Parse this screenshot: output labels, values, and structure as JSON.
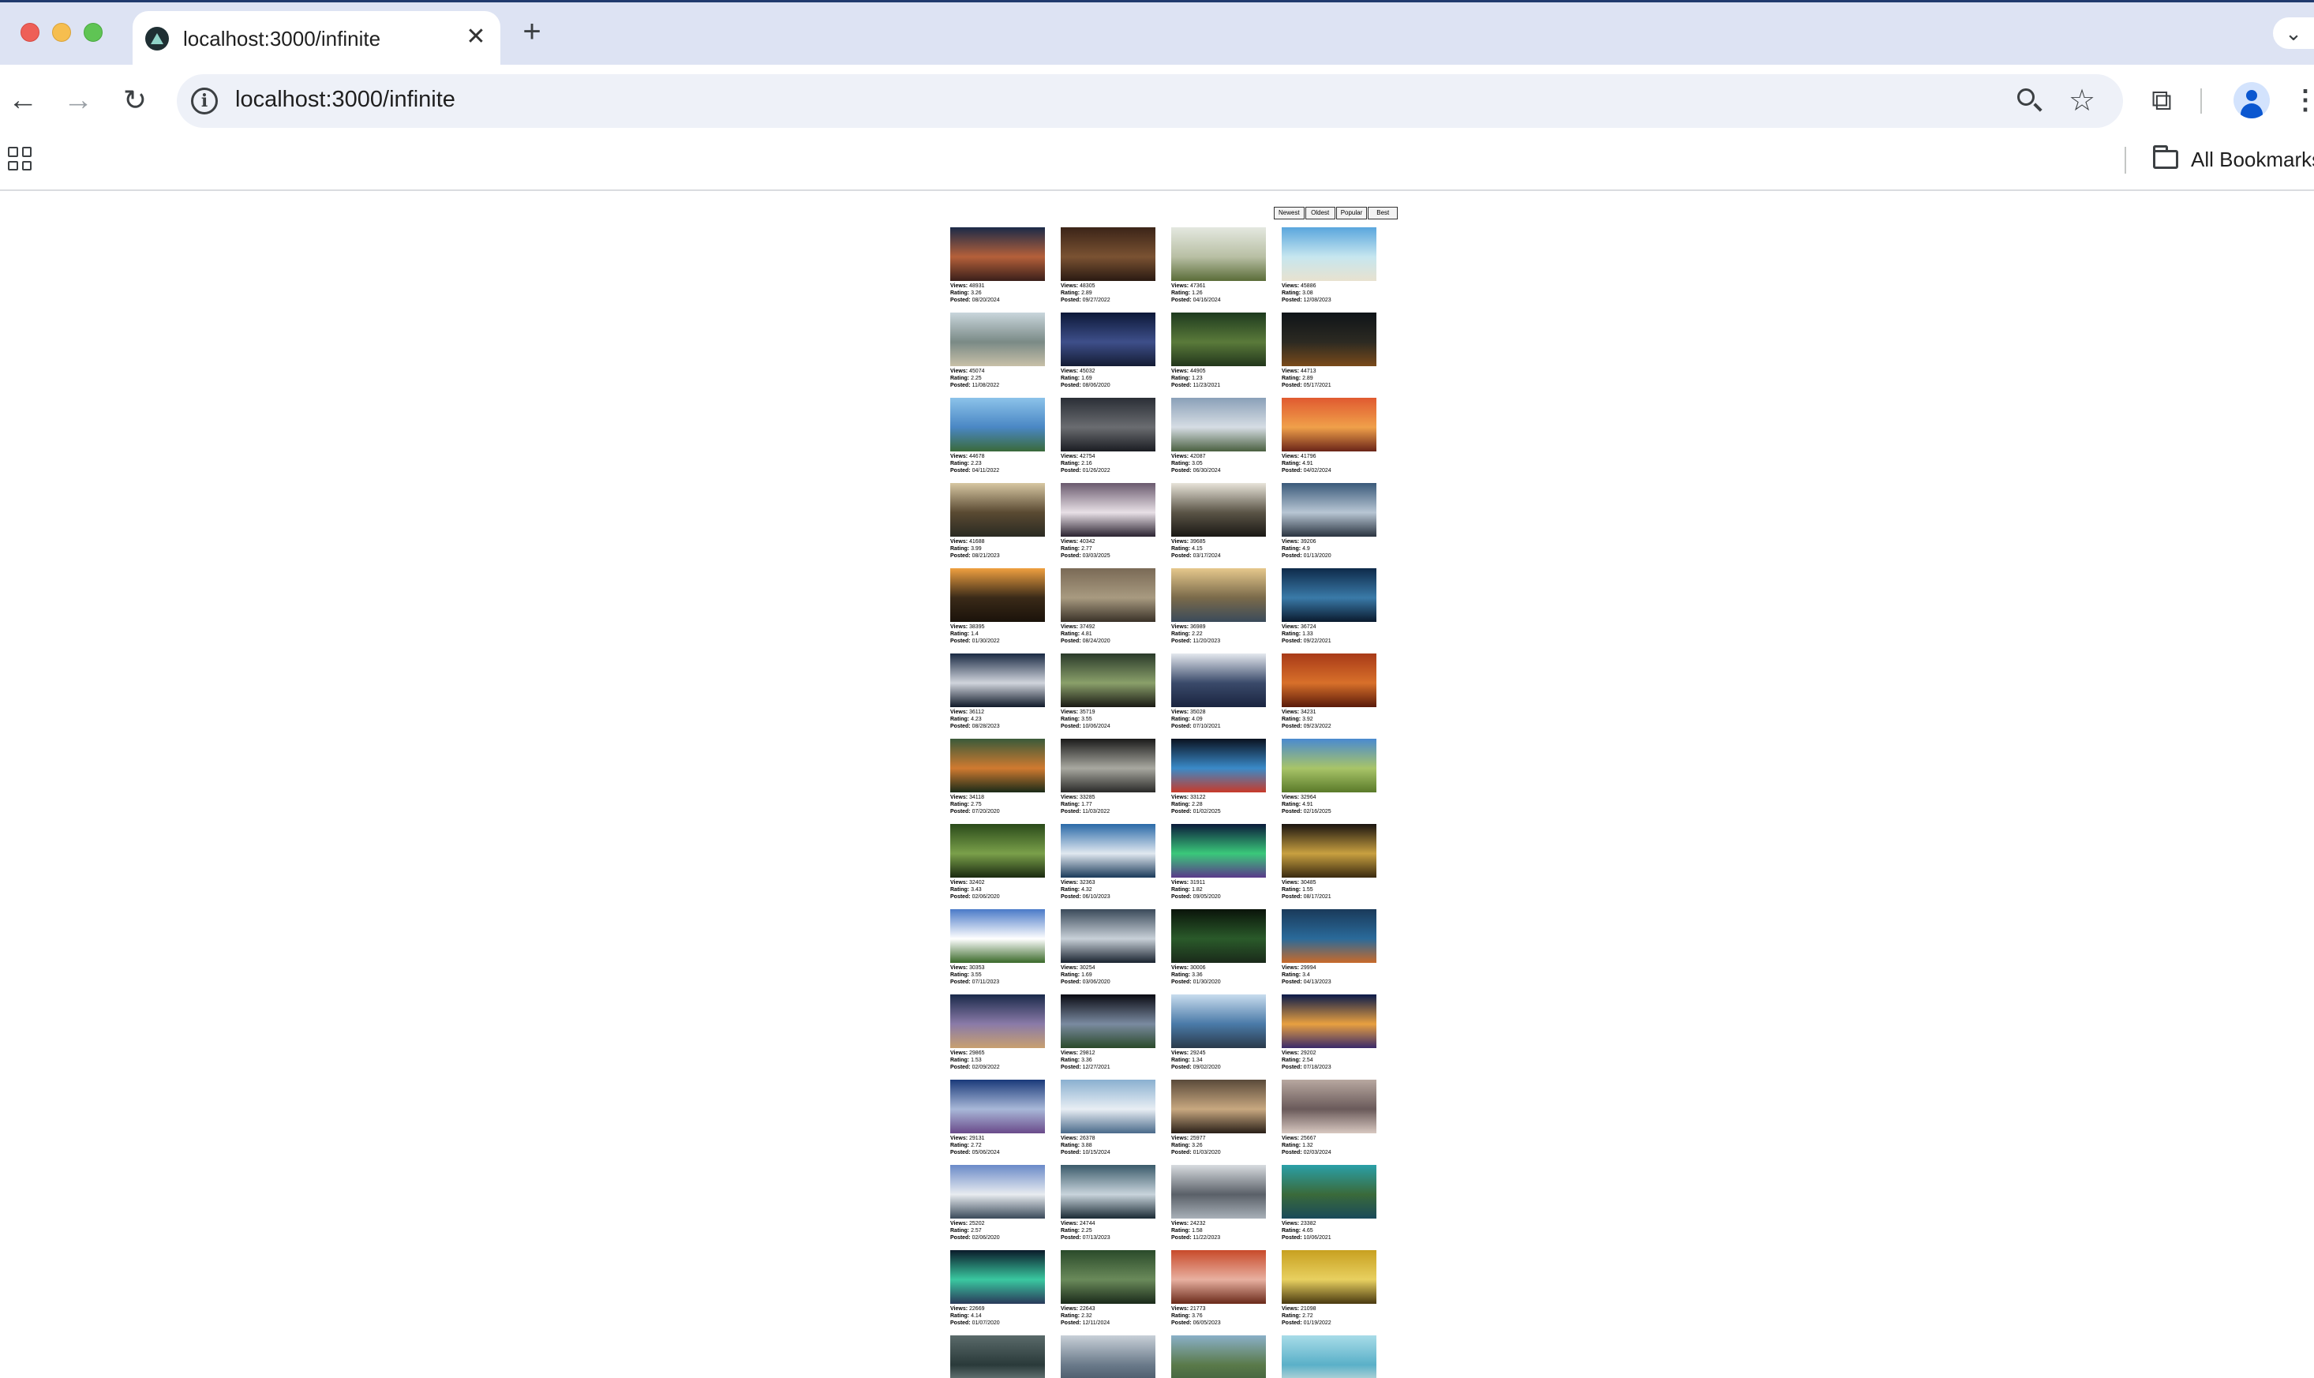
{
  "browser": {
    "tab_title": "localhost:3000/infinite",
    "new_tab_label": "+",
    "close_tab_label": "✕",
    "url": "localhost:3000/infinite",
    "bookmarks_label": "All Bookmarks"
  },
  "labels": {
    "views": "Views:",
    "rating": "Rating:",
    "posted": "Posted:"
  },
  "sort_options": [
    "Newest",
    "Oldest",
    "Popular",
    "Best"
  ],
  "photos": [
    {
      "views": "48931",
      "rating": "3.26",
      "posted": "08/20/2024",
      "colors": [
        "#1b2a48",
        "#b5603a",
        "#3a1f1a"
      ]
    },
    {
      "views": "48305",
      "rating": "2.89",
      "posted": "09/27/2022",
      "colors": [
        "#3b2418",
        "#7a5232",
        "#2a1a12"
      ]
    },
    {
      "views": "47361",
      "rating": "1.26",
      "posted": "04/16/2024",
      "colors": [
        "#e4e8e0",
        "#b8bfa4",
        "#5a6c38"
      ]
    },
    {
      "views": "45886",
      "rating": "3.08",
      "posted": "12/08/2023",
      "colors": [
        "#5aa6dd",
        "#c6e6ef",
        "#e8e2cf"
      ]
    },
    {
      "views": "45074",
      "rating": "2.25",
      "posted": "11/08/2022",
      "colors": [
        "#c9d6dc",
        "#7a8a86",
        "#c8c0a8"
      ]
    },
    {
      "views": "45032",
      "rating": "1.69",
      "posted": "08/06/2020",
      "colors": [
        "#0c1838",
        "#3e4f8a",
        "#141c34"
      ]
    },
    {
      "views": "44905",
      "rating": "1.23",
      "posted": "11/23/2021",
      "colors": [
        "#1e3a1e",
        "#5a7a3a",
        "#22361c"
      ]
    },
    {
      "views": "44713",
      "rating": "2.89",
      "posted": "05/17/2021",
      "colors": [
        "#0f1418",
        "#2c2a22",
        "#7a4a1a"
      ]
    },
    {
      "views": "44678",
      "rating": "2.23",
      "posted": "04/11/2022",
      "colors": [
        "#8cc3ea",
        "#4a87c4",
        "#3a6a3a"
      ]
    },
    {
      "views": "42754",
      "rating": "2.16",
      "posted": "01/26/2022",
      "colors": [
        "#2a2e36",
        "#6a6c70",
        "#1a1c22"
      ]
    },
    {
      "views": "42087",
      "rating": "3.05",
      "posted": "06/30/2024",
      "colors": [
        "#8aa0b8",
        "#d6dde4",
        "#4a6040"
      ]
    },
    {
      "views": "41796",
      "rating": "4.91",
      "posted": "04/02/2024",
      "colors": [
        "#e05a30",
        "#f0a04a",
        "#6a2418"
      ]
    },
    {
      "views": "41688",
      "rating": "3.99",
      "posted": "08/21/2023",
      "colors": [
        "#d7c7a2",
        "#5a4a32",
        "#2a2a22"
      ]
    },
    {
      "views": "40342",
      "rating": "2.77",
      "posted": "03/03/2025",
      "colors": [
        "#6a5a6e",
        "#e8e0e6",
        "#2a2230"
      ]
    },
    {
      "views": "39685",
      "rating": "4.15",
      "posted": "03/17/2024",
      "colors": [
        "#e8e4da",
        "#5a5446",
        "#1a1814"
      ]
    },
    {
      "views": "39206",
      "rating": "4.9",
      "posted": "01/13/2020",
      "colors": [
        "#3a5a7a",
        "#b8c6d4",
        "#2a3440"
      ]
    },
    {
      "views": "38395",
      "rating": "1.4",
      "posted": "01/30/2022",
      "colors": [
        "#f0a040",
        "#3a2a18",
        "#1a120a"
      ]
    },
    {
      "views": "37492",
      "rating": "4.81",
      "posted": "08/24/2020",
      "colors": [
        "#7a6a56",
        "#a89a80",
        "#3a3228"
      ]
    },
    {
      "views": "36989",
      "rating": "2.22",
      "posted": "11/20/2023",
      "colors": [
        "#e6c88c",
        "#7a6a4a",
        "#3a4a5a"
      ]
    },
    {
      "views": "36724",
      "rating": "1.33",
      "posted": "09/22/2021",
      "colors": [
        "#0e2a4a",
        "#3a7aa8",
        "#0a1a2e"
      ]
    },
    {
      "views": "36112",
      "rating": "4.23",
      "posted": "08/28/2023",
      "colors": [
        "#1a2a44",
        "#d0d4dc",
        "#101a2a"
      ]
    },
    {
      "views": "35719",
      "rating": "3.55",
      "posted": "10/06/2024",
      "colors": [
        "#2a3a2a",
        "#8aa06a",
        "#1a1a14"
      ]
    },
    {
      "views": "35028",
      "rating": "4.09",
      "posted": "07/10/2021",
      "colors": [
        "#e4e8ee",
        "#3a4a6a",
        "#1a2440"
      ]
    },
    {
      "views": "34231",
      "rating": "3.92",
      "posted": "09/23/2022",
      "colors": [
        "#a83a18",
        "#d8702a",
        "#5a1a0a"
      ]
    },
    {
      "views": "34118",
      "rating": "2.75",
      "posted": "07/20/2020",
      "colors": [
        "#3a5a3a",
        "#d07a30",
        "#1a2a18"
      ]
    },
    {
      "views": "33285",
      "rating": "1.77",
      "posted": "11/03/2022",
      "colors": [
        "#1a1a1a",
        "#a8a8a0",
        "#2a2a28"
      ]
    },
    {
      "views": "33122",
      "rating": "2.28",
      "posted": "01/02/2025",
      "colors": [
        "#0a1220",
        "#3a8ac8",
        "#c83a2a"
      ]
    },
    {
      "views": "32964",
      "rating": "4.91",
      "posted": "02/16/2025",
      "colors": [
        "#4a8ad0",
        "#a8c468",
        "#5a7a2a"
      ]
    },
    {
      "views": "32402",
      "rating": "3.43",
      "posted": "02/06/2020",
      "colors": [
        "#2a4a1a",
        "#7aa04a",
        "#1a2a10"
      ]
    },
    {
      "views": "32363",
      "rating": "4.32",
      "posted": "06/10/2023",
      "colors": [
        "#2a6aa8",
        "#e0e8f0",
        "#1a3a5a"
      ]
    },
    {
      "views": "31911",
      "rating": "1.82",
      "posted": "09/05/2020",
      "colors": [
        "#0a1a3a",
        "#3ac87a",
        "#5a3a8a"
      ]
    },
    {
      "views": "30485",
      "rating": "1.55",
      "posted": "08/17/2021",
      "colors": [
        "#1a1410",
        "#c8a040",
        "#3a2a10"
      ]
    },
    {
      "views": "30353",
      "rating": "3.55",
      "posted": "07/11/2023",
      "colors": [
        "#4a7ac8",
        "#ffffff",
        "#3a6a2a"
      ]
    },
    {
      "views": "30254",
      "rating": "1.69",
      "posted": "03/06/2020",
      "colors": [
        "#3a4a5a",
        "#c8d0d8",
        "#1a2430"
      ]
    },
    {
      "views": "30006",
      "rating": "3.36",
      "posted": "01/30/2020",
      "colors": [
        "#0a140a",
        "#2a5a2a",
        "#1a2a1a"
      ]
    },
    {
      "views": "29994",
      "rating": "3.4",
      "posted": "04/13/2023",
      "colors": [
        "#1a3a5a",
        "#2a6a9a",
        "#c86a2a"
      ]
    },
    {
      "views": "29865",
      "rating": "1.53",
      "posted": "02/09/2022",
      "colors": [
        "#1a2a4a",
        "#8a7aa8",
        "#c8a070"
      ]
    },
    {
      "views": "29812",
      "rating": "3.36",
      "posted": "12/27/2021",
      "colors": [
        "#0a0a12",
        "#7a8aa0",
        "#2a4a2a"
      ]
    },
    {
      "views": "29245",
      "rating": "1.34",
      "posted": "09/02/2020",
      "colors": [
        "#c8dcee",
        "#4a7aa8",
        "#2a3a4a"
      ]
    },
    {
      "views": "29202",
      "rating": "2.54",
      "posted": "07/18/2023",
      "colors": [
        "#0a1a4a",
        "#e8a040",
        "#3a2a6a"
      ]
    },
    {
      "views": "29131",
      "rating": "2.72",
      "posted": "05/06/2024",
      "colors": [
        "#1a3a7a",
        "#a8b8d8",
        "#6a4a8a"
      ]
    },
    {
      "views": "26378",
      "rating": "3.88",
      "posted": "10/15/2024",
      "colors": [
        "#8ab0d0",
        "#e8eef4",
        "#4a6a8a"
      ]
    },
    {
      "views": "25977",
      "rating": "3.26",
      "posted": "01/03/2020",
      "colors": [
        "#5a4a3a",
        "#c8a880",
        "#2a2018"
      ]
    },
    {
      "views": "25667",
      "rating": "1.32",
      "posted": "02/03/2024",
      "colors": [
        "#b8a8a0",
        "#6a5a5a",
        "#d8c8c0"
      ]
    },
    {
      "views": "25202",
      "rating": "2.57",
      "posted": "02/06/2020",
      "colors": [
        "#6a8ac8",
        "#e8ecf0",
        "#3a4a5a"
      ]
    },
    {
      "views": "24744",
      "rating": "2.25",
      "posted": "07/13/2023",
      "colors": [
        "#3a5a6a",
        "#c8d4dc",
        "#1a2a34"
      ]
    },
    {
      "views": "24232",
      "rating": "1.58",
      "posted": "11/22/2023",
      "colors": [
        "#d8dce0",
        "#5a6068",
        "#a8b0b8"
      ]
    },
    {
      "views": "23382",
      "rating": "4.65",
      "posted": "10/06/2021",
      "colors": [
        "#2aa0a8",
        "#3a6a3a",
        "#1a4a5a"
      ]
    },
    {
      "views": "22669",
      "rating": "4.14",
      "posted": "01/07/2020",
      "colors": [
        "#0a1a2a",
        "#3ac8a0",
        "#2a3a5a"
      ]
    },
    {
      "views": "22643",
      "rating": "2.32",
      "posted": "12/11/2024",
      "colors": [
        "#2a4a2a",
        "#6a8a5a",
        "#1a2a1a"
      ]
    },
    {
      "views": "21773",
      "rating": "3.76",
      "posted": "06/05/2023",
      "colors": [
        "#c84a2a",
        "#e8b0a0",
        "#6a2a1a"
      ]
    },
    {
      "views": "21098",
      "rating": "2.72",
      "posted": "01/19/2022",
      "colors": [
        "#c8a020",
        "#e8d060",
        "#4a3a10"
      ]
    },
    {
      "views": "",
      "rating": "",
      "posted": "",
      "colors": [
        "#5a6a6a",
        "#2a3a3a",
        "#8a9a9a"
      ]
    },
    {
      "views": "",
      "rating": "",
      "posted": "",
      "colors": [
        "#c8d0d8",
        "#6a7a8a",
        "#3a4a5a"
      ]
    },
    {
      "views": "",
      "rating": "",
      "posted": "",
      "colors": [
        "#8ab0c8",
        "#5a7a4a",
        "#3a5a3a"
      ]
    },
    {
      "views": "",
      "rating": "",
      "posted": "",
      "colors": [
        "#a8dce8",
        "#5ab0c8",
        "#e8e8e0"
      ]
    }
  ]
}
